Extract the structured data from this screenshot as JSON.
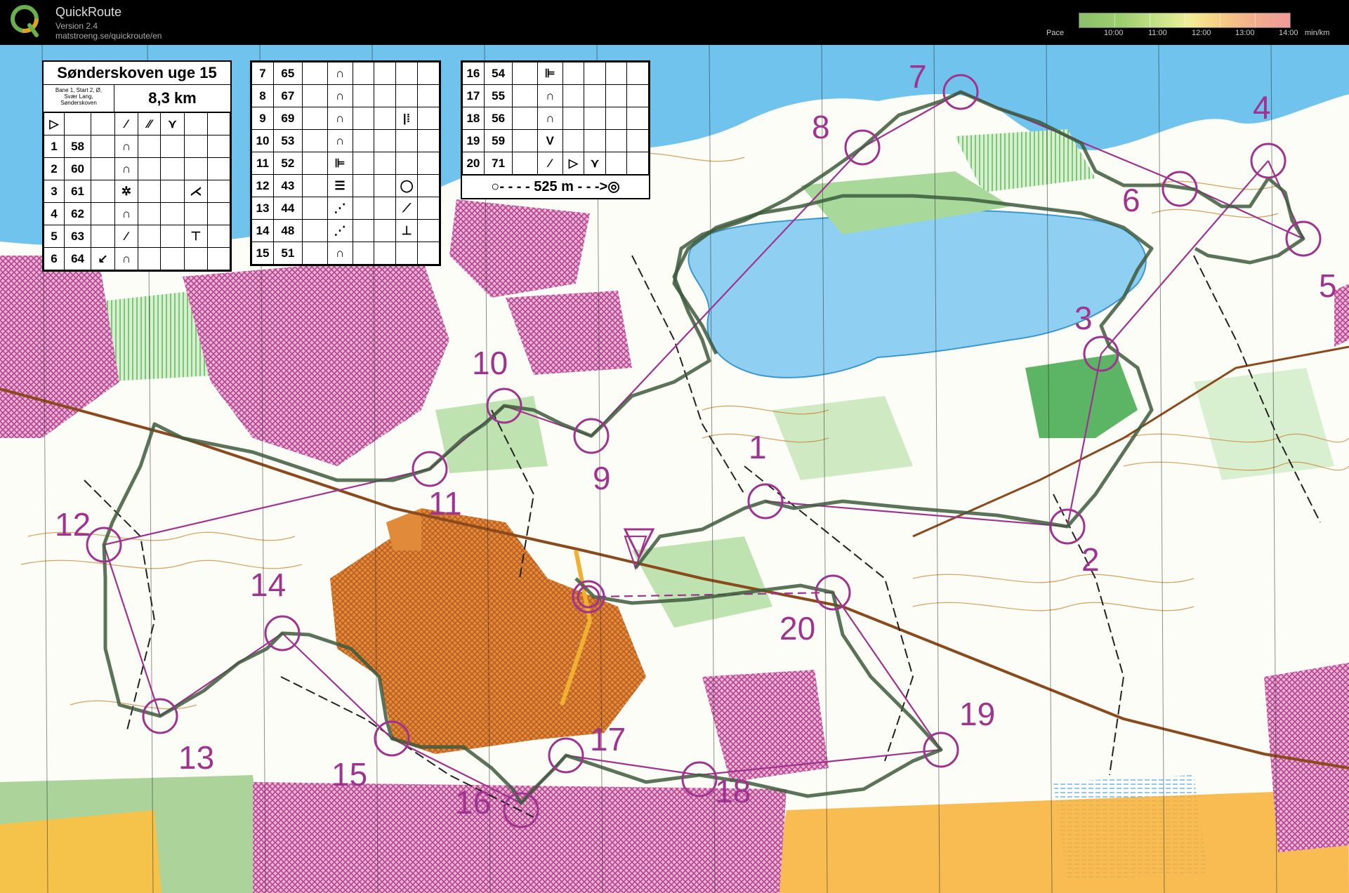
{
  "app": {
    "title": "QuickRoute",
    "version": "Version 2.4",
    "url": "matstroeng.se/quickroute/en"
  },
  "pace_legend": {
    "label": "Pace",
    "ticks": [
      "10:00",
      "11:00",
      "12:00",
      "13:00",
      "14:00"
    ],
    "unit": "min/km"
  },
  "course": {
    "title": "Sønderskoven uge 15",
    "info": [
      "Bane 1, Start 2, Ø,",
      "Svær Lang,",
      "Sønderskoven"
    ],
    "length": "8,3 km",
    "finish_distance": "525 m",
    "controls_a": [
      {
        "n": "1",
        "code": "58"
      },
      {
        "n": "2",
        "code": "60"
      },
      {
        "n": "3",
        "code": "61"
      },
      {
        "n": "4",
        "code": "62"
      },
      {
        "n": "5",
        "code": "63"
      },
      {
        "n": "6",
        "code": "64"
      }
    ],
    "controls_b": [
      {
        "n": "7",
        "code": "65"
      },
      {
        "n": "8",
        "code": "67"
      },
      {
        "n": "9",
        "code": "69"
      },
      {
        "n": "10",
        "code": "53"
      },
      {
        "n": "11",
        "code": "52"
      },
      {
        "n": "12",
        "code": "43"
      },
      {
        "n": "13",
        "code": "44"
      },
      {
        "n": "14",
        "code": "48"
      },
      {
        "n": "15",
        "code": "51"
      }
    ],
    "controls_c": [
      {
        "n": "16",
        "code": "54"
      },
      {
        "n": "17",
        "code": "55"
      },
      {
        "n": "18",
        "code": "56"
      },
      {
        "n": "19",
        "code": "59"
      },
      {
        "n": "20",
        "code": "71"
      }
    ]
  },
  "map_labels": [
    "1",
    "2",
    "3",
    "4",
    "5",
    "6",
    "7",
    "8",
    "9",
    "10",
    "11",
    "12",
    "13",
    "14",
    "15",
    "16",
    "17",
    "18",
    "19",
    "20"
  ],
  "colors": {
    "course": "#a0338f",
    "route": "#3d5a3d",
    "water": "#6fc3ec",
    "forest_green": "#5db85d",
    "orange": "#e88a2e",
    "purple_hatch": "#b8428f"
  }
}
